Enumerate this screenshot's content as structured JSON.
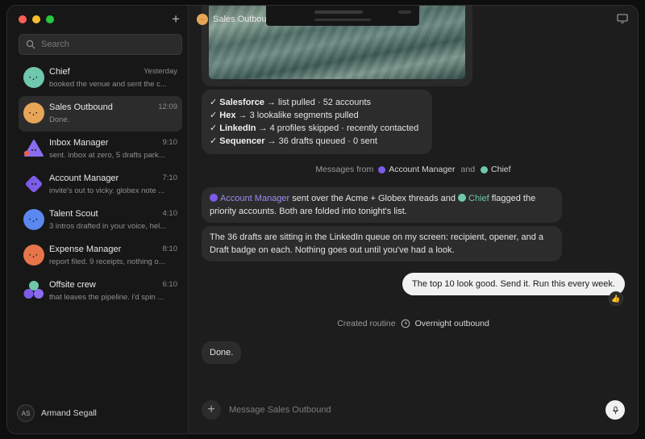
{
  "colors": {
    "traffic_close": "#ff5f57",
    "traffic_min": "#febc2e",
    "traffic_max": "#28c840",
    "chief": "#6fc7ad",
    "sales_outbound": "#e8a557",
    "inbox_manager": "#8b6cf0",
    "account_manager": "#7d5ce8",
    "talent_scout": "#5a88f0",
    "expense_manager": "#e8744a"
  },
  "sidebar": {
    "new_label": "+",
    "search_placeholder": "Search",
    "conversations": [
      {
        "name": "Chief",
        "time": "Yesterday",
        "preview": "booked the venue and sent the c..."
      },
      {
        "name": "Sales Outbound",
        "time": "12:09",
        "preview": "Done."
      },
      {
        "name": "Inbox Manager",
        "time": "9:10",
        "preview": "sent. inbox at zero, 5 drafts park..."
      },
      {
        "name": "Account Manager",
        "time": "7:10",
        "preview": "invite's out to vicky. globex note ..."
      },
      {
        "name": "Talent Scout",
        "time": "4:10",
        "preview": "3 intros drafted in your voice, hel..."
      },
      {
        "name": "Expense Manager",
        "time": "8:10",
        "preview": "report filed. 9 receipts, nothing o..."
      },
      {
        "name": "Offsite crew",
        "time": "6:10",
        "preview": "that leaves the pipeline. i'd spin ..."
      }
    ],
    "user": {
      "initials": "AS",
      "name": "Armand Segall"
    }
  },
  "header": {
    "title": "Sales Outbound"
  },
  "chat": {
    "checklist": [
      {
        "check": "✓",
        "tool": "Salesforce",
        "detail": "→ list pulled · 52 accounts"
      },
      {
        "check": "✓",
        "tool": "Hex",
        "detail": "→ 3 lookalike segments pulled"
      },
      {
        "check": "✓",
        "tool": "LinkedIn",
        "detail": "→ 4 profiles skipped · recently contacted"
      },
      {
        "check": "✓",
        "tool": "Sequencer",
        "detail": "→ 36 drafts queued · 0 sent"
      }
    ],
    "messages_from": {
      "prefix": "Messages from",
      "agent1": "Account Manager",
      "joiner": "and",
      "agent2": "Chief"
    },
    "msg1": {
      "agent1": "Account Manager",
      "text1": " sent over the Acme + Globex threads and ",
      "agent2": "Chief",
      "text2": " flagged the priority accounts. Both are folded into tonight's list."
    },
    "msg2": "The 36 drafts are sitting in the LinkedIn queue on my screen: recipient, opener, and a Draft badge on each. Nothing goes out until you've had a look.",
    "user_msg": "The top 10 look good. Send it. Run this every week.",
    "reaction": "👍",
    "routine": {
      "prefix": "Created routine",
      "name": "Overnight outbound"
    },
    "done": "Done."
  },
  "composer": {
    "add_label": "+",
    "placeholder": "Message Sales Outbound"
  }
}
